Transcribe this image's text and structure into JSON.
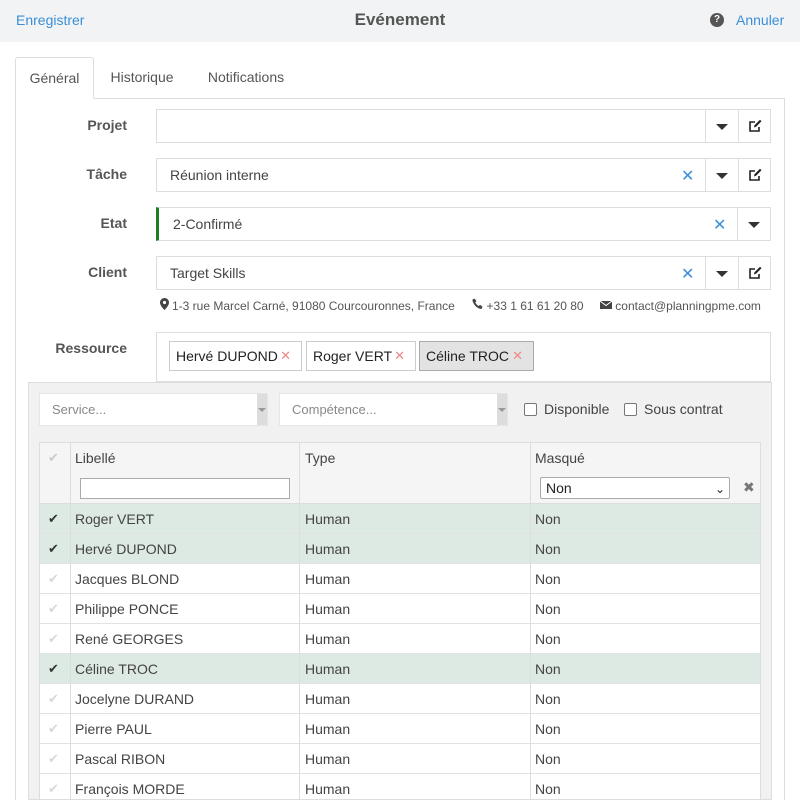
{
  "header": {
    "save_label": "Enregistrer",
    "title": "Evénement",
    "cancel_label": "Annuler",
    "help_symbol": "?"
  },
  "tabs": [
    {
      "label": "Général",
      "active": true
    },
    {
      "label": "Historique",
      "active": false
    },
    {
      "label": "Notifications",
      "active": false
    }
  ],
  "form": {
    "projet": {
      "label": "Projet",
      "value": ""
    },
    "tache": {
      "label": "Tâche",
      "value": "Réunion interne"
    },
    "etat": {
      "label": "Etat",
      "value": "2-Confirmé",
      "color": "#1e7d22"
    },
    "client": {
      "label": "Client",
      "value": "Target Skills"
    },
    "client_info": {
      "address": "1-3 rue Marcel Carné, 91080 Courcouronnes, France",
      "phone": "+33 1 61 61 20 80",
      "email": "contact@planningpme.com"
    },
    "ressource": {
      "label": "Ressource",
      "chips": [
        "Hervé DUPOND",
        "Roger VERT",
        "Céline TROC"
      ]
    }
  },
  "filters": {
    "service_placeholder": "Service...",
    "competence_placeholder": "Compétence...",
    "disponible_label": "Disponible",
    "sous_contrat_label": "Sous contrat"
  },
  "table": {
    "columns": [
      "Libellé",
      "Type",
      "Masqué"
    ],
    "masque_filter_value": "Non",
    "rows": [
      {
        "name": "Roger VERT",
        "type": "Human",
        "masque": "Non",
        "checked": true
      },
      {
        "name": "Hervé DUPOND",
        "type": "Human",
        "masque": "Non",
        "checked": true
      },
      {
        "name": "Jacques BLOND",
        "type": "Human",
        "masque": "Non",
        "checked": false
      },
      {
        "name": "Philippe PONCE",
        "type": "Human",
        "masque": "Non",
        "checked": false
      },
      {
        "name": "René GEORGES",
        "type": "Human",
        "masque": "Non",
        "checked": false
      },
      {
        "name": "Céline TROC",
        "type": "Human",
        "masque": "Non",
        "checked": true
      },
      {
        "name": "Jocelyne DURAND",
        "type": "Human",
        "masque": "Non",
        "checked": false
      },
      {
        "name": "Pierre PAUL",
        "type": "Human",
        "masque": "Non",
        "checked": false
      },
      {
        "name": "Pascal RIBON",
        "type": "Human",
        "masque": "Non",
        "checked": false
      },
      {
        "name": "François MORDE",
        "type": "Human",
        "masque": "Non",
        "checked": false
      }
    ]
  },
  "colors": {
    "accent": "#3a8fd8",
    "checked_row": "#dde9e3",
    "etat_bar": "#1e7d22"
  }
}
